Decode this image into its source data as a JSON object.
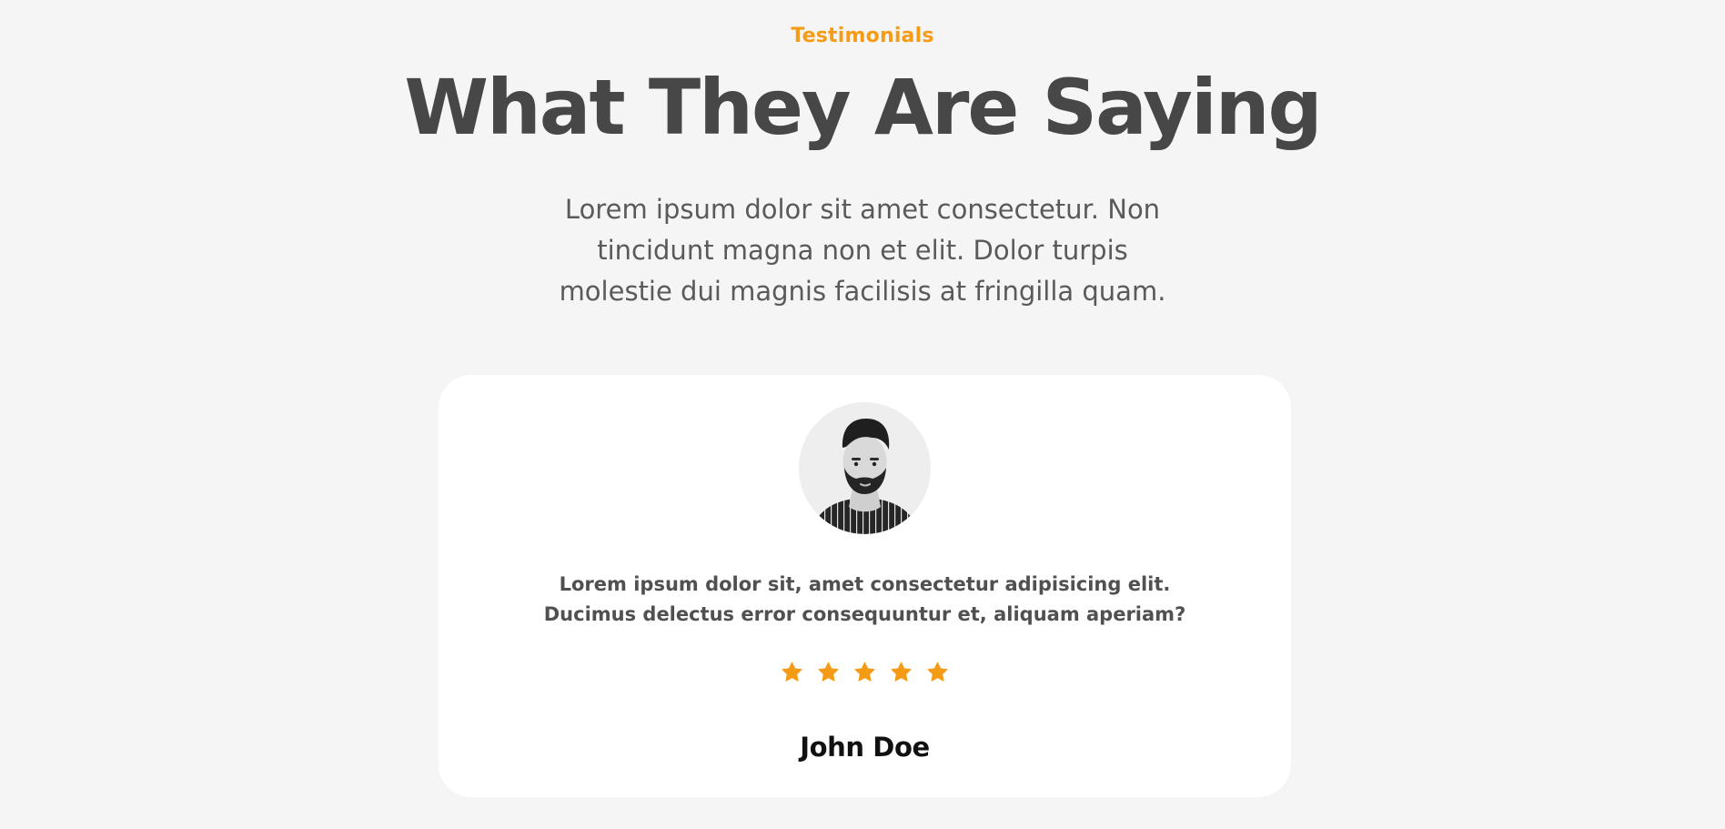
{
  "section": {
    "eyebrow": "Testimonials",
    "title": "What They Are Saying",
    "subtitle": "Lorem ipsum dolor sit amet consectetur. Non tincidunt magna non et elit. Dolor turpis molestie dui magnis facilisis at fringilla quam."
  },
  "testimonial": {
    "avatar_icon": "person-portrait-icon",
    "quote_lines": [
      "Lorem ipsum dolor sit, amet consectetur adipisicing elit.",
      "Ducimus delectus error consequuntur et, aliquam aperiam?"
    ],
    "rating": 5,
    "rating_max": 5,
    "name": "John Doe"
  },
  "colors": {
    "accent": "#f59c17",
    "background": "#f5f5f5",
    "card": "#ffffff",
    "heading": "#474747",
    "name": "#111111"
  },
  "icons": {
    "star": "star-icon"
  }
}
